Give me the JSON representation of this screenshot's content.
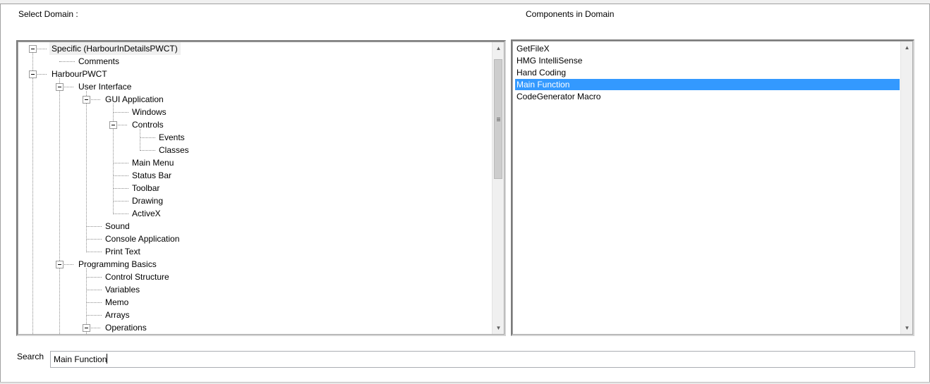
{
  "labels": {
    "select_domain": "Select Domain :",
    "components_in_domain": "Components in Domain",
    "search": "Search"
  },
  "tree": {
    "nodes": [
      "Specific (HarbourInDetailsPWCT)",
      "Comments",
      "HarbourPWCT",
      "User Interface",
      "GUI Application",
      "Windows",
      "Controls",
      "Events",
      "Classes",
      "Main Menu",
      "Status Bar",
      "Toolbar",
      "Drawing",
      "ActiveX",
      "Sound",
      "Console Application",
      "Print Text",
      "Programming Basics",
      "Control Structure",
      "Variables",
      "Memo",
      "Arrays",
      "Operations"
    ]
  },
  "components": {
    "items": [
      "GetFileX",
      "HMG IntelliSense",
      "Hand Coding",
      "Main Function",
      "CodeGenerator Macro"
    ],
    "selected": "Main Function"
  },
  "search": {
    "value": "Main Function"
  },
  "colors": {
    "selection": "#3399ff",
    "selected_text": "#ffffff"
  }
}
